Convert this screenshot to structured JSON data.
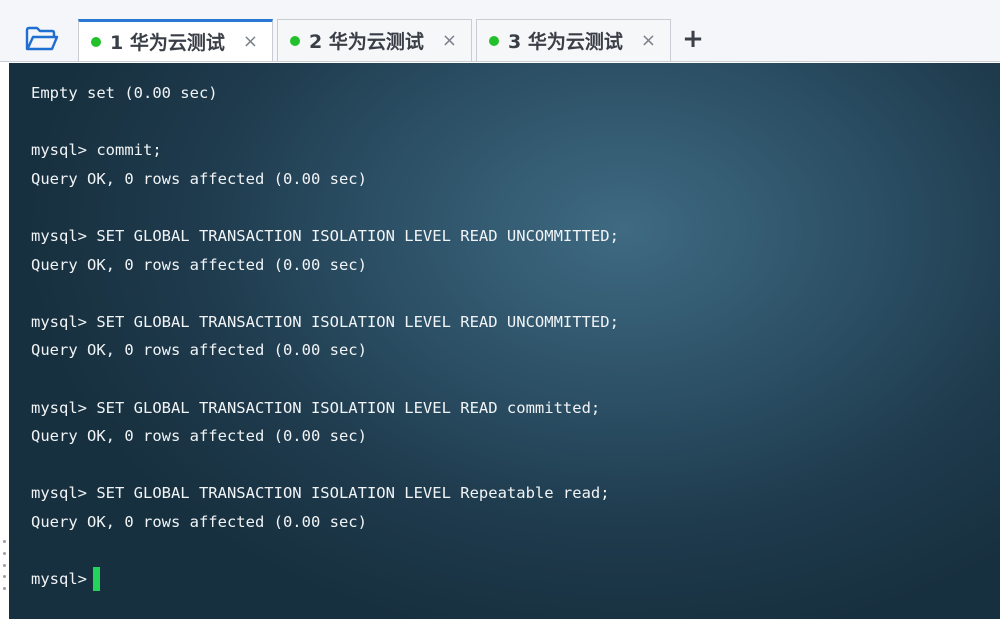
{
  "colors": {
    "tab_dot": "#22c02a",
    "cursor": "#22d45a",
    "active_tab_accent": "#2a78d6",
    "folder_icon": "#1f6fd0"
  },
  "toolbar": {
    "folder_icon": "folder-open-icon",
    "add_tab_label": "+"
  },
  "tabs": [
    {
      "label": "1 华为云测试",
      "close": "×",
      "active": true
    },
    {
      "label": "2 华为云测试",
      "close": "×",
      "active": false
    },
    {
      "label": "3 华为云测试",
      "close": "×",
      "active": false
    }
  ],
  "terminal": {
    "lines": [
      "Empty set (0.00 sec)",
      "",
      "mysql> commit;",
      "Query OK, 0 rows affected (0.00 sec)",
      "",
      "mysql> SET GLOBAL TRANSACTION ISOLATION LEVEL READ UNCOMMITTED;",
      "Query OK, 0 rows affected (0.00 sec)",
      "",
      "mysql> SET GLOBAL TRANSACTION ISOLATION LEVEL READ UNCOMMITTED;",
      "Query OK, 0 rows affected (0.00 sec)",
      "",
      "mysql> SET GLOBAL TRANSACTION ISOLATION LEVEL READ committed;",
      "Query OK, 0 rows affected (0.00 sec)",
      "",
      "mysql> SET GLOBAL TRANSACTION ISOLATION LEVEL Repeatable read;",
      "Query OK, 0 rows affected (0.00 sec)",
      ""
    ],
    "prompt": "mysql>"
  }
}
